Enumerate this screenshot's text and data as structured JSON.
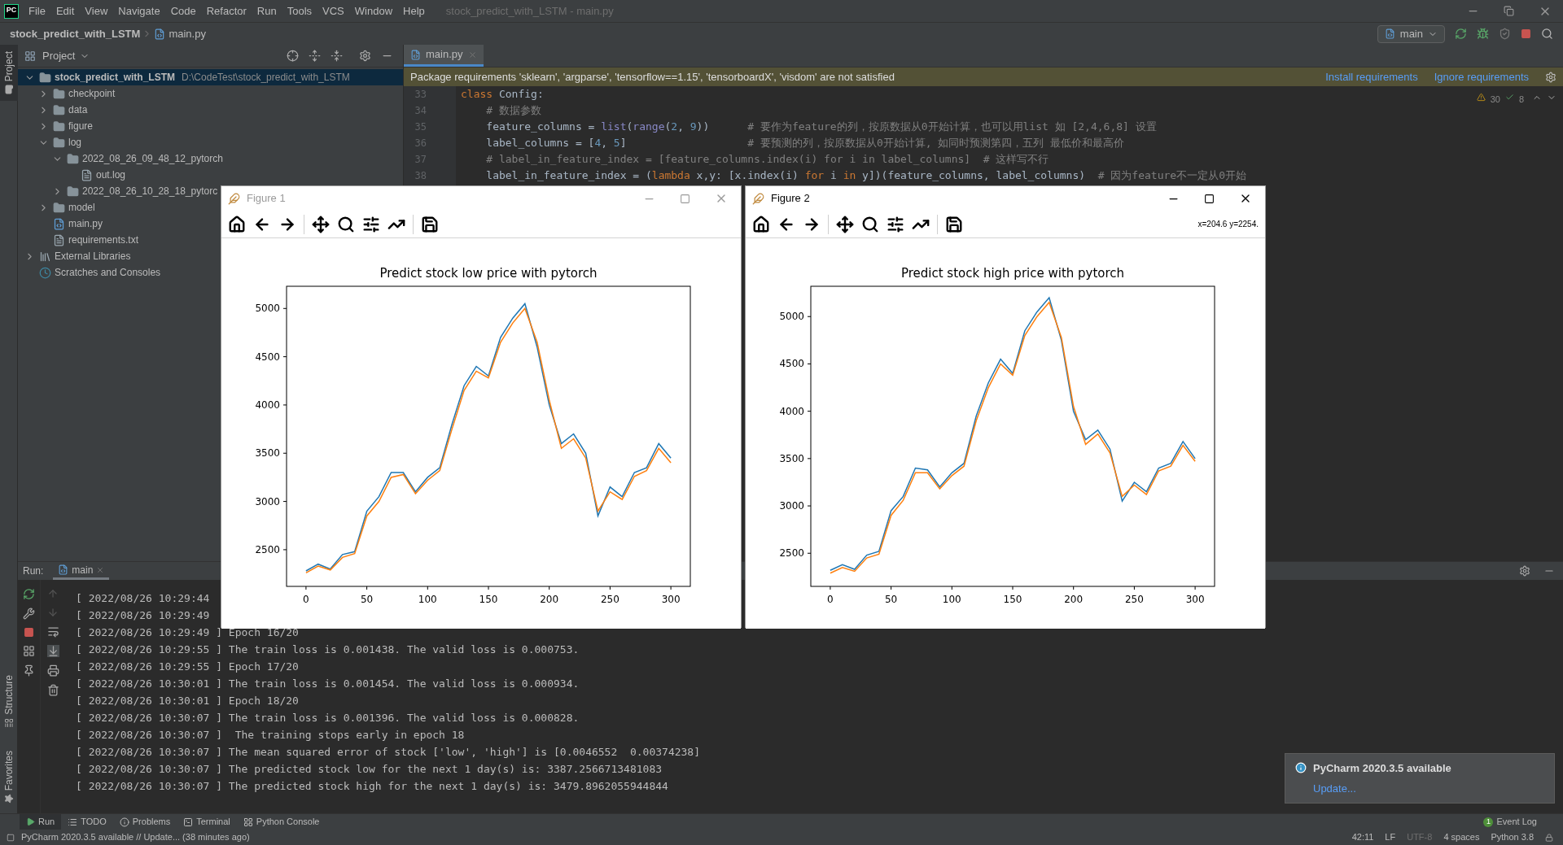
{
  "menu_bar": {
    "logo": "PC",
    "items": [
      "File",
      "Edit",
      "View",
      "Navigate",
      "Code",
      "Refactor",
      "Run",
      "Tools",
      "VCS",
      "Window",
      "Help"
    ],
    "window_title": "stock_predict_with_LSTM - main.py"
  },
  "breadcrumb": [
    "stock_predict_with_LSTM",
    "main.py"
  ],
  "run_config": "main",
  "side_tabs": {
    "top": [
      {
        "label": "Project",
        "selected": true
      }
    ],
    "bottom": [
      {
        "label": "Structure",
        "selected": false
      },
      {
        "label": "Favorites",
        "selected": false
      }
    ]
  },
  "project_panel": {
    "title": "Project",
    "tree": [
      {
        "name": "stock_predict_with_LSTM",
        "path": "D:\\CodeTest\\stock_predict_with_LSTM",
        "kind": "folder",
        "expanded": true,
        "selected": true,
        "children": [
          {
            "name": "checkpoint",
            "kind": "folder",
            "expanded": false,
            "selected": false
          },
          {
            "name": "data",
            "kind": "folder",
            "expanded": false,
            "selected": false
          },
          {
            "name": "figure",
            "kind": "folder",
            "expanded": false,
            "selected": false
          },
          {
            "name": "log",
            "kind": "folder",
            "expanded": true,
            "selected": false,
            "children": [
              {
                "name": "2022_08_26_09_48_12_pytorch",
                "kind": "folder",
                "expanded": true,
                "selected": false,
                "children": [
                  {
                    "name": "out.log",
                    "kind": "text",
                    "selected": false
                  }
                ]
              },
              {
                "name": "2022_08_26_10_28_18_pytorc",
                "kind": "folder",
                "expanded": false,
                "selected": false
              }
            ]
          },
          {
            "name": "model",
            "kind": "folder",
            "expanded": false,
            "selected": false
          },
          {
            "name": "main.py",
            "kind": "python",
            "selected": false
          },
          {
            "name": "requirements.txt",
            "kind": "text",
            "selected": false
          }
        ]
      },
      {
        "name": "External Libraries",
        "kind": "library",
        "expanded": false,
        "selected": false
      },
      {
        "name": "Scratches and Consoles",
        "kind": "scratches",
        "selected": false
      }
    ]
  },
  "editor": {
    "tabs": [
      {
        "label": "main.py",
        "selected": true
      }
    ],
    "banner": {
      "text": "Package requirements 'sklearn', 'argparse', 'tensorflow==1.15', 'tensorboardX', 'visdom' are not satisfied",
      "actions": [
        "Install requirements",
        "Ignore requirements"
      ]
    },
    "inspections": {
      "warnings": "30",
      "passed": "8"
    },
    "lines": [
      {
        "number": "33",
        "tokens": [
          {
            "text": "class",
            "kind": "keyword"
          },
          {
            "text": " Config:",
            "kind": "plain"
          }
        ]
      },
      {
        "number": "34",
        "tokens": [
          {
            "text": "    # 数据参数",
            "kind": "comment"
          }
        ]
      },
      {
        "number": "35",
        "tokens": [
          {
            "text": "    feature_columns = ",
            "kind": "plain"
          },
          {
            "text": "list",
            "kind": "builtin"
          },
          {
            "text": "(",
            "kind": "plain"
          },
          {
            "text": "range",
            "kind": "builtin"
          },
          {
            "text": "(",
            "kind": "plain"
          },
          {
            "text": "2",
            "kind": "number"
          },
          {
            "text": ", ",
            "kind": "plain"
          },
          {
            "text": "9",
            "kind": "number"
          },
          {
            "text": "))      ",
            "kind": "plain"
          },
          {
            "text": "# 要作为feature的列，按原数据从0开始计算，也可以用list 如 [2,4,6,8] 设置",
            "kind": "comment"
          }
        ]
      },
      {
        "number": "36",
        "tokens": [
          {
            "text": "    label_columns = [",
            "kind": "plain"
          },
          {
            "text": "4",
            "kind": "number"
          },
          {
            "text": ", ",
            "kind": "plain"
          },
          {
            "text": "5",
            "kind": "number"
          },
          {
            "text": "]                   ",
            "kind": "plain"
          },
          {
            "text": "# 要预测的列，按原数据从0开始计算, 如同时预测第四，五列 最低价和最高价",
            "kind": "comment"
          }
        ]
      },
      {
        "number": "37",
        "tokens": [
          {
            "text": "    # label_in_feature_index = [feature_columns.index(i) for i in label_columns]  # 这样写不行",
            "kind": "comment"
          }
        ]
      },
      {
        "number": "38",
        "tokens": [
          {
            "text": "    label_in_feature_index = (",
            "kind": "plain"
          },
          {
            "text": "lambda",
            "kind": "keyword"
          },
          {
            "text": " x,y: [x.index(i) ",
            "kind": "plain"
          },
          {
            "text": "for",
            "kind": "keyword"
          },
          {
            "text": " i ",
            "kind": "plain"
          },
          {
            "text": "in",
            "kind": "keyword"
          },
          {
            "text": " y])(feature_columns, label_columns)  ",
            "kind": "plain"
          },
          {
            "text": "# 因为feature不一定从0开始",
            "kind": "comment"
          }
        ]
      }
    ]
  },
  "figures": [
    {
      "title": "Figure 1",
      "active": false,
      "chart_data": {
        "type": "line",
        "title": "Predict stock low price with pytorch",
        "x": [
          0,
          10,
          20,
          30,
          40,
          50,
          60,
          70,
          80,
          90,
          100,
          110,
          120,
          130,
          140,
          150,
          160,
          170,
          180,
          190,
          200,
          210,
          220,
          230,
          240,
          250,
          260,
          270,
          280,
          290,
          300
        ],
        "xlim": [
          -16,
          316
        ],
        "ylim": [
          2120,
          5230
        ],
        "xticks": [
          0,
          50,
          100,
          150,
          200,
          250,
          300
        ],
        "yticks": [
          2500,
          3000,
          3500,
          4000,
          4500,
          5000
        ],
        "series": [
          {
            "color": "#1f77b4",
            "values": [
              2280,
              2350,
              2300,
              2450,
              2480,
              2900,
              3050,
              3300,
              3300,
              3100,
              3250,
              3350,
              3800,
              4200,
              4400,
              4300,
              4700,
              4900,
              5050,
              4600,
              4000,
              3600,
              3700,
              3500,
              2850,
              3150,
              3050,
              3300,
              3350,
              3600,
              3450
            ]
          },
          {
            "color": "#ff7f0e",
            "values": [
              2260,
              2330,
              2290,
              2420,
              2460,
              2850,
              3000,
              3250,
              3280,
              3080,
              3220,
              3320,
              3750,
              4150,
              4350,
              4280,
              4650,
              4850,
              5000,
              4650,
              4050,
              3550,
              3650,
              3450,
              2900,
              3100,
              3020,
              3260,
              3320,
              3550,
              3400
            ]
          }
        ]
      }
    },
    {
      "title": "Figure 2",
      "active": true,
      "cursor_readout": "x=204.6 y=2254.",
      "chart_data": {
        "type": "line",
        "title": "Predict stock high price with pytorch",
        "x": [
          0,
          10,
          20,
          30,
          40,
          50,
          60,
          70,
          80,
          90,
          100,
          110,
          120,
          130,
          140,
          150,
          160,
          170,
          180,
          190,
          200,
          210,
          220,
          230,
          240,
          250,
          260,
          270,
          280,
          290,
          300
        ],
        "xlim": [
          -16,
          316
        ],
        "ylim": [
          2150,
          5320
        ],
        "xticks": [
          0,
          50,
          100,
          150,
          200,
          250,
          300
        ],
        "yticks": [
          2500,
          3000,
          3500,
          4000,
          4500,
          5000
        ],
        "series": [
          {
            "color": "#1f77b4",
            "values": [
              2320,
              2380,
              2330,
              2480,
              2520,
              2950,
              3100,
              3400,
              3380,
              3200,
              3350,
              3450,
              3950,
              4300,
              4550,
              4400,
              4850,
              5050,
              5200,
              4750,
              4000,
              3700,
              3800,
              3600,
              3050,
              3250,
              3150,
              3400,
              3450,
              3680,
              3500
            ]
          },
          {
            "color": "#ff7f0e",
            "values": [
              2290,
              2350,
              2310,
              2450,
              2490,
              2900,
              3060,
              3350,
              3350,
              3180,
              3320,
              3420,
              3900,
              4250,
              4500,
              4380,
              4800,
              5000,
              5150,
              4780,
              4050,
              3650,
              3760,
              3560,
              3100,
              3220,
              3120,
              3370,
              3420,
              3640,
              3470
            ]
          }
        ]
      }
    }
  ],
  "run_panel": {
    "label": "Run:",
    "tabs": [
      {
        "label": "main",
        "selected": true
      }
    ],
    "console": [
      "[ 2022/08/26 10:29:44",
      "[ 2022/08/26 10:29:49",
      "[ 2022/08/26 10:29:49 ] Epoch 16/20",
      "[ 2022/08/26 10:29:55 ] The train loss is 0.001438. The valid loss is 0.000753.",
      "[ 2022/08/26 10:29:55 ] Epoch 17/20",
      "[ 2022/08/26 10:30:01 ] The train loss is 0.001454. The valid loss is 0.000934.",
      "[ 2022/08/26 10:30:01 ] Epoch 18/20",
      "[ 2022/08/26 10:30:07 ] The train loss is 0.001396. The valid loss is 0.000828.",
      "[ 2022/08/26 10:30:07 ]  The training stops early in epoch 18",
      "[ 2022/08/26 10:30:07 ] The mean squared error of stock ['low', 'high'] is [0.0046552  0.00374238]",
      "[ 2022/08/26 10:30:07 ] The predicted stock low for the next 1 day(s) is: 3387.2566713481083",
      "[ 2022/08/26 10:30:07 ] The predicted stock high for the next 1 day(s) is: 3479.8962055944844"
    ]
  },
  "notification": {
    "title": "PyCharm 2020.3.5 available",
    "action": "Update..."
  },
  "tool_tabs": [
    {
      "label": "Run",
      "kind": "run",
      "selected": true
    },
    {
      "label": "TODO",
      "kind": "todo",
      "selected": false
    },
    {
      "label": "Problems",
      "kind": "problems",
      "selected": false
    },
    {
      "label": "Terminal",
      "kind": "terminal",
      "selected": false
    },
    {
      "label": "Python Console",
      "kind": "console",
      "selected": false
    }
  ],
  "event_log": {
    "label": "Event Log",
    "count": "1"
  },
  "status_bar": {
    "message": "PyCharm 2020.3.5 available // Update... (38 minutes ago)",
    "items": [
      {
        "text": "42:11",
        "disabled": false
      },
      {
        "text": "LF",
        "disabled": false
      },
      {
        "text": "UTF-8",
        "disabled": true
      },
      {
        "text": "4 spaces",
        "disabled": false
      },
      {
        "text": "Python 3.8",
        "disabled": false
      }
    ]
  }
}
